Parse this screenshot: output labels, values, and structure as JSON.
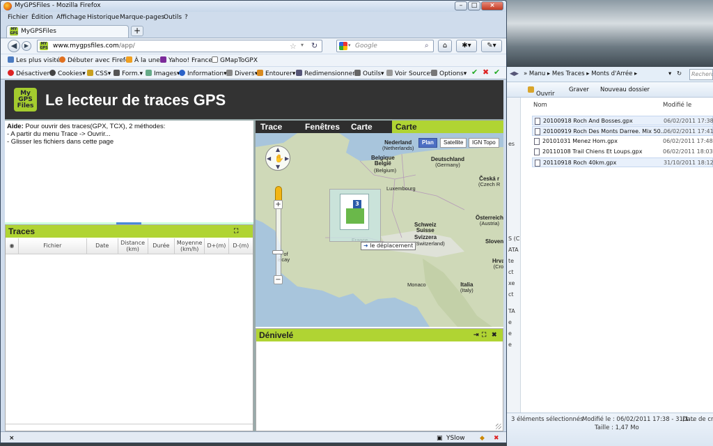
{
  "firefox": {
    "title": "MyGPSFiles - Mozilla Firefox",
    "menu": [
      "Fichier",
      "Édition",
      "Affichage",
      "Historique",
      "Marque-pages",
      "Outils",
      "?"
    ],
    "tab_title": "MyGPSFiles",
    "new_tab": "+",
    "url_host": "www.mygpsfiles.com",
    "url_path": "/app/",
    "search_placeholder": "Google",
    "bookmarks": [
      "Les plus visités",
      "Débuter avec Firefox",
      "À la une",
      "Yahoo! France",
      "GMapToGPX"
    ],
    "webdev": [
      "Désactiver",
      "Cookies",
      "CSS",
      "Form.",
      "Images",
      "Information",
      "Divers",
      "Entourer",
      "Redimensionner",
      "Outils",
      "Voir Source",
      "Options"
    ],
    "status_close": "×",
    "status_yslow": "YSlow"
  },
  "site": {
    "logo_lines": [
      "My",
      "GPS",
      "Files"
    ],
    "title": "Le lecteur de traces GPS",
    "help": {
      "label": "Aide:",
      "intro": " Pour ouvrir des traces(GPX, TCX), 2 méthodes:",
      "line1": "- A partir du menu Trace -> Ouvrir...",
      "line2": "- Glisser les fichiers dans cette page"
    },
    "traces": {
      "title": "Traces",
      "columns": [
        {
          "l1": "Fichier",
          "l2": ""
        },
        {
          "l1": "Date",
          "l2": ""
        },
        {
          "l1": "Distance",
          "l2": "(km)"
        },
        {
          "l1": "Durée",
          "l2": ""
        },
        {
          "l1": "Moyenne",
          "l2": "(km/h)"
        },
        {
          "l1": "D+(m)",
          "l2": ""
        },
        {
          "l1": "D-(m)",
          "l2": ""
        }
      ]
    },
    "menu_tabs": [
      "Trace",
      "Fenêtres",
      "Carte",
      "Carte"
    ],
    "map_types": [
      "Plan",
      "Satellite",
      "IGN Topo"
    ],
    "map_labels": [
      {
        "name": "Nederland",
        "sub": "(Netherlands)"
      },
      {
        "name": "Belgique",
        "sub": "België"
      },
      {
        "name": "",
        "sub": "(Belgium)"
      },
      {
        "name": "Deutschland",
        "sub": "(Germany)"
      },
      {
        "name": "Luxembourg",
        "sub": ""
      },
      {
        "name": "Česká r",
        "sub": "(Czech R"
      },
      {
        "name": "Schweiz",
        "sub": "Suisse"
      },
      {
        "name": "Svizzera",
        "sub": "(Switzerland)"
      },
      {
        "name": "Österreich",
        "sub": "(Austria)"
      },
      {
        "name": "Sloven",
        "sub": ""
      },
      {
        "name": "Hrva",
        "sub": "(Cro"
      },
      {
        "name": "Monaco",
        "sub": ""
      },
      {
        "name": "Italia",
        "sub": "(Italy)"
      },
      {
        "name": "France",
        "sub": ""
      },
      {
        "name": "y of",
        "sub": "iscay"
      }
    ],
    "drag_badge": "3",
    "drag_tooltip": "le déplacement",
    "denivele_title": "Dénivelé"
  },
  "explorer": {
    "breadcrumb": [
      "Manu",
      "Mes Traces",
      "Monts d'Arrée"
    ],
    "search_placeholder": "Recherc",
    "commands": [
      "Ouvrir",
      "Graver",
      "Nouveau dossier"
    ],
    "col_name": "Nom",
    "col_modified": "Modifié le",
    "files": [
      {
        "name": "20100918 Roch And Bosses.gpx",
        "date": "06/02/2011 17:38"
      },
      {
        "name": "20100919 Roch Des Monts Darree. Mix 50...",
        "date": "06/02/2011 17:41"
      },
      {
        "name": "20101031 Menez Hom.gpx",
        "date": "06/02/2011 17:48"
      },
      {
        "name": "20110108 Trail Chiens Et Loups.gpx",
        "date": "06/02/2011 18:03"
      },
      {
        "name": "20110918 Roch 40km.gpx",
        "date": "31/10/2011 18:12"
      }
    ],
    "details": {
      "count": "3 éléments sélectionnés",
      "modified": "Modifié le : 06/02/2011 17:38 - 31/1...",
      "created": "Date de cré",
      "size": "Taille : 1,47 Mo"
    },
    "left_fragments": [
      "es",
      "S (C",
      "ATA",
      "te",
      "ct",
      "xe",
      "ct",
      "TA",
      "e",
      "e",
      "e"
    ]
  }
}
